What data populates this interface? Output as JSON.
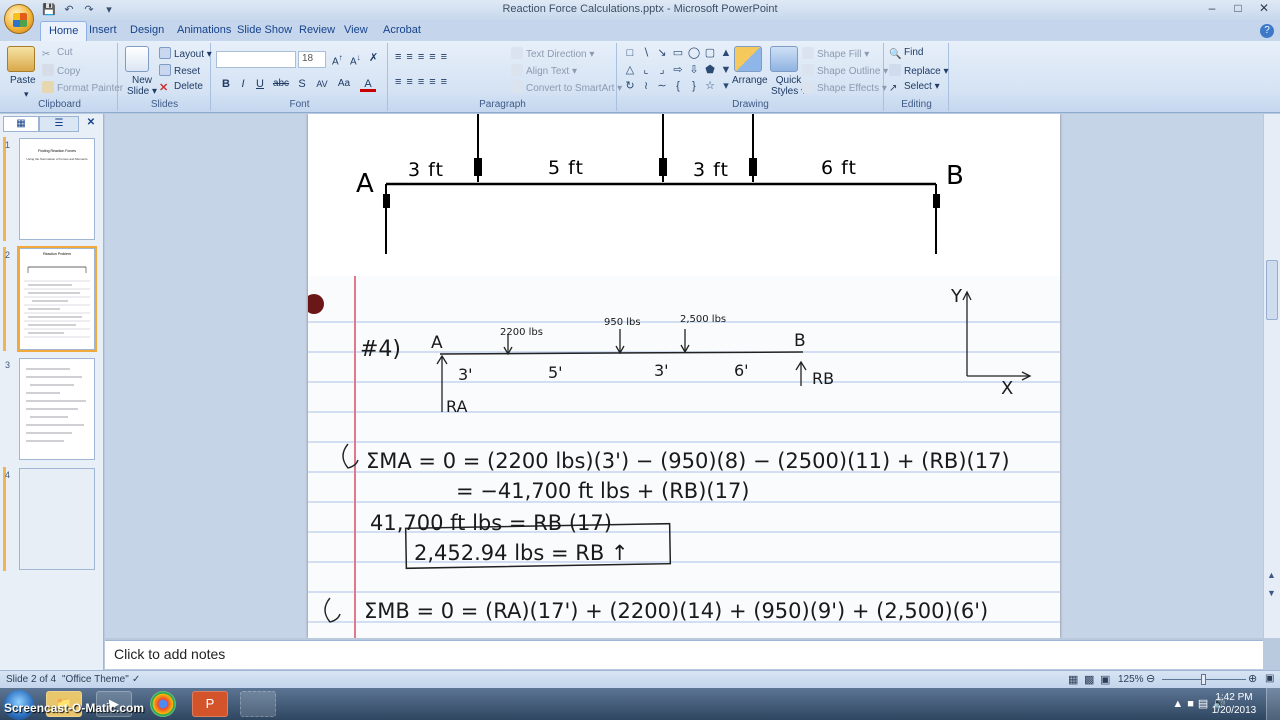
{
  "app": {
    "window_title": "Reaction Force Calculations.pptx - Microsoft PowerPoint"
  },
  "quick_access": [
    "save-icon",
    "undo-icon",
    "redo-icon",
    "dropdown-icon"
  ],
  "tabs": [
    "Home",
    "Insert",
    "Design",
    "Animations",
    "Slide Show",
    "Review",
    "View",
    "Acrobat"
  ],
  "active_tab": "Home",
  "ribbon": {
    "clipboard": {
      "paste": "Paste",
      "cut": "Cut",
      "copy": "Copy",
      "format_painter": "Format Painter",
      "label": "Clipboard"
    },
    "slides": {
      "new_slide": "New Slide",
      "new_slide_line1": "New",
      "new_slide_line2": "Slide",
      "layout": "Layout",
      "reset": "Reset",
      "delete": "Delete",
      "label": "Slides"
    },
    "font": {
      "font_name": "",
      "font_size": "18",
      "bold": "B",
      "italic": "I",
      "underline": "U",
      "strike": "abc",
      "shadow": "S",
      "spacing": "AV",
      "case": "Aa",
      "color": "A",
      "label": "Font"
    },
    "paragraph": {
      "text_direction": "Text Direction",
      "align_text": "Align Text",
      "convert_smartart": "Convert to SmartArt",
      "label": "Paragraph"
    },
    "drawing": {
      "arrange": "Arrange",
      "quick_styles_line1": "Quick",
      "quick_styles_line2": "Styles",
      "shape_fill": "Shape Fill",
      "shape_outline": "Shape Outline",
      "shape_effects": "Shape Effects",
      "label": "Drawing"
    },
    "editing": {
      "find": "Find",
      "replace": "Replace",
      "select": "Select",
      "label": "Editing"
    }
  },
  "thumbnails": [
    {
      "number": "1",
      "title": "Finding Reaction Forces",
      "subtitle": "Using the Summation of Forces and Moments"
    },
    {
      "number": "2",
      "title": "Reaction Problem"
    },
    {
      "number": "3"
    },
    {
      "number": "4"
    }
  ],
  "slide": {
    "diagram": {
      "point_a": "A",
      "point_b": "B",
      "spans": [
        "3 ft",
        "5 ft",
        "3 ft",
        "6 ft"
      ]
    },
    "handwritten": {
      "problem_number": "#4)",
      "loads": [
        "2200 lbs",
        "950 lbs",
        "2,500 lbs"
      ],
      "spans": [
        "3'",
        "5'",
        "3'",
        "6'"
      ],
      "point_a": "A",
      "point_b": "B",
      "reaction_a": "RA",
      "reaction_b": "RB",
      "axis_y": "Y",
      "axis_x": "X",
      "line1": "ΣMA = 0 = (2200 lbs)(3') − (950)(8) − (2500)(11) + (RB)(17)",
      "line2": "= −41,700 ft lbs + (RB)(17)",
      "line3": "41,700 ft lbs = RB (17)",
      "answer": "2,452.94 lbs = RB ↑",
      "line4": "ΣMB = 0 = (RA)(17') + (2200)(14) + (950)(9') + (2,500)(6')"
    }
  },
  "notes_placeholder": "Click to add notes",
  "statusbar": {
    "slide_info": "Slide 2 of 4",
    "theme": "\"Office Theme\"",
    "zoom": "125%"
  },
  "taskbar": {
    "screencast_label": "Screencast-O-Matic.com",
    "time": "1:42 PM",
    "date": "1/20/2013"
  }
}
